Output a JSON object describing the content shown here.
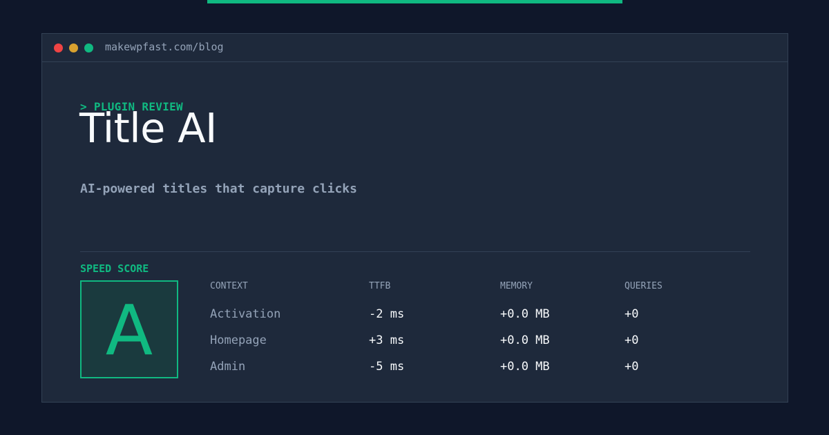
{
  "colors": {
    "background": "#0f172a",
    "panel": "#1e293b",
    "accent": "#10b981",
    "dot_red": "#ef4444",
    "dot_yellow": "#d9a22f",
    "dot_green": "#10b981"
  },
  "window": {
    "url": "makewpfast.com/blog"
  },
  "hero": {
    "eyebrow": "> PLUGIN REVIEW",
    "title": "Title AI",
    "subtitle": "AI-powered titles that capture clicks"
  },
  "score": {
    "label": "SPEED SCORE",
    "grade": "A"
  },
  "metrics": {
    "headers": [
      "CONTEXT",
      "TTFB",
      "MEMORY",
      "QUERIES"
    ],
    "rows": [
      [
        "Activation",
        "-2 ms",
        "+0.0 MB",
        "+0"
      ],
      [
        "Homepage",
        "+3 ms",
        "+0.0 MB",
        "+0"
      ],
      [
        "Admin",
        "-5 ms",
        "+0.0 MB",
        "+0"
      ]
    ]
  }
}
